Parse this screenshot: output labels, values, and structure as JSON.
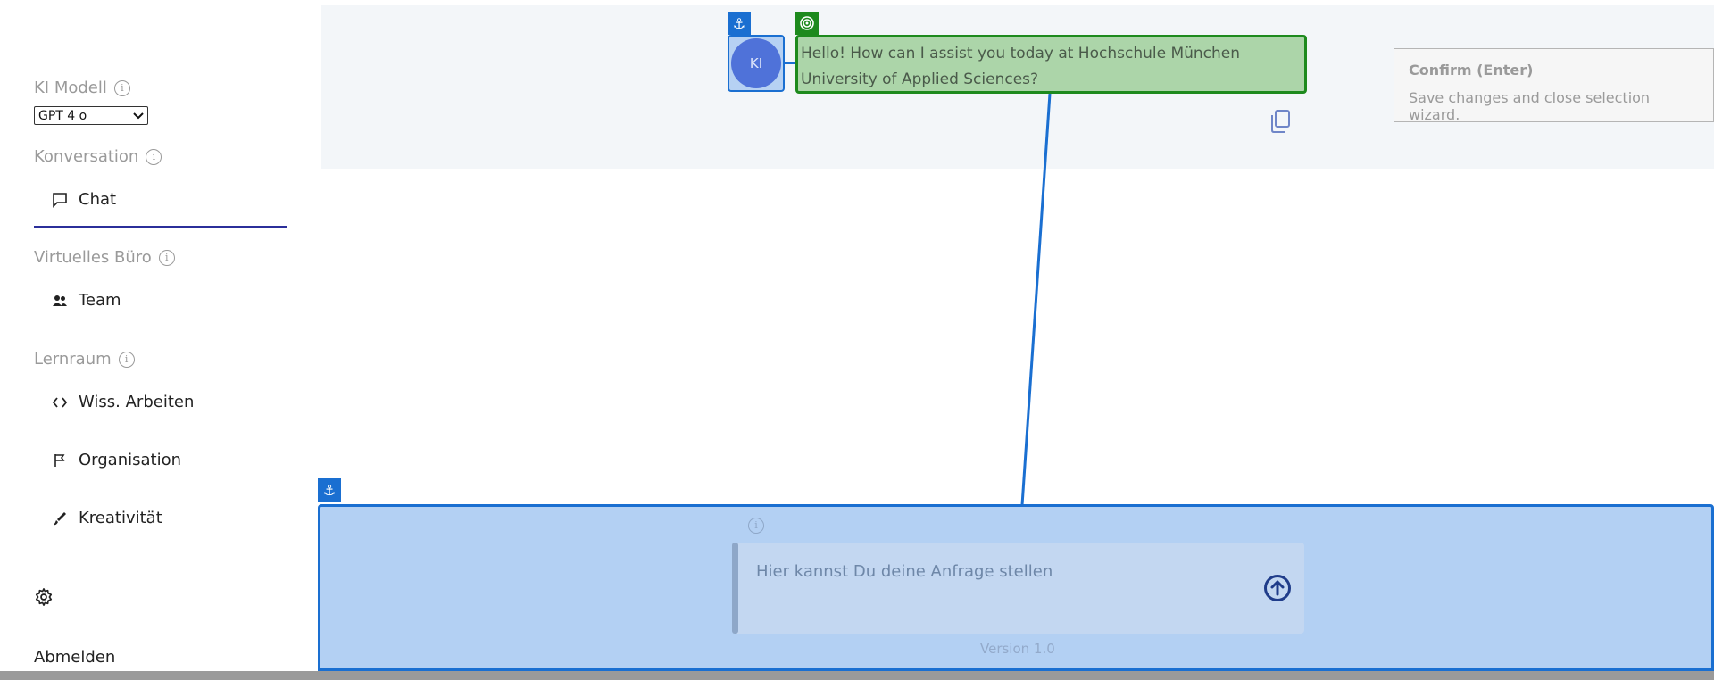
{
  "sidebar": {
    "model_label": "KI Modell",
    "model_value": "GPT 4 o",
    "conversation_label": "Konversation",
    "chat_label": "Chat",
    "office_label": "Virtuelles Büro",
    "team_label": "Team",
    "learning_label": "Lernraum",
    "learning_items": [
      "Wiss. Arbeiten",
      "Organisation",
      "Kreativität"
    ],
    "logout_label": "Abmelden",
    "info_glyph": "i"
  },
  "chat": {
    "avatar_text": "KI",
    "message": "Hello! How can I assist you today at Hochschule München University of Applied Sciences?"
  },
  "tooltip": {
    "title": "Confirm (Enter)",
    "body": "Save changes and close selection wizard."
  },
  "input": {
    "placeholder": "Hier kannst Du deine Anfrage stellen",
    "version": "Version 1.0"
  },
  "icons": {
    "anchor": "anchor-icon",
    "target": "target-icon",
    "copy": "copy-icon",
    "send": "arrow-up-circle-icon",
    "settings": "gear-icon"
  },
  "colors": {
    "accent_blue": "#1a6fd1",
    "accent_green": "#1d8a1d",
    "nav_underline": "#2b2f9a"
  }
}
